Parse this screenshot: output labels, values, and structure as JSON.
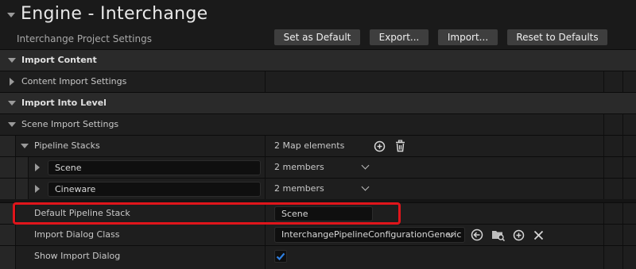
{
  "header": {
    "title": "Engine - Interchange",
    "subtitle": "Interchange Project Settings",
    "buttons": {
      "set_default": "Set as Default",
      "export": "Export...",
      "import": "Import...",
      "reset": "Reset to Defaults"
    }
  },
  "sections": {
    "import_content": "Import Content",
    "content_import_settings": "Content Import Settings",
    "import_into_level": "Import Into Level",
    "scene_import_settings": "Scene Import Settings"
  },
  "pipeline_stacks": {
    "label": "Pipeline Stacks",
    "value": "2 Map elements",
    "entries": [
      {
        "key": "Scene",
        "value": "2 members"
      },
      {
        "key": "Cineware",
        "value": "2 members"
      }
    ]
  },
  "default_pipeline_stack": {
    "label": "Default Pipeline Stack",
    "value": "Scene"
  },
  "import_dialog_class": {
    "label": "Import Dialog Class",
    "value": "InterchangePipelineConfigurationGeneric"
  },
  "show_import_dialog": {
    "label": "Show Import Dialog",
    "checked": true
  },
  "colors": {
    "highlight": "#e0151b",
    "check": "#2f7fe0"
  },
  "icons": [
    "add-element-icon",
    "delete-icon",
    "chevron-down-icon",
    "browse-back-icon",
    "browse-folder-icon",
    "add-icon",
    "clear-icon",
    "checkmark-icon"
  ]
}
